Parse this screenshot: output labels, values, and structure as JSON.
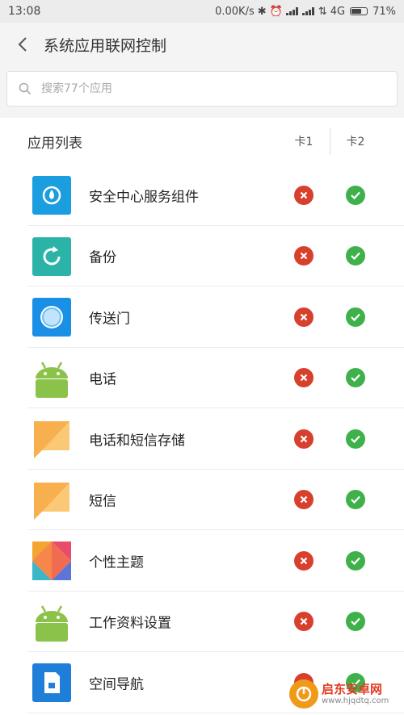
{
  "status": {
    "time": "13:08",
    "speed": "0.00K/s",
    "network": "4G",
    "battery": "71%",
    "battery_level": 0.71
  },
  "header": {
    "title": "系统应用联网控制"
  },
  "search": {
    "placeholder": "搜索77个应用"
  },
  "list": {
    "label": "应用列表",
    "col1": "卡1",
    "col2": "卡2",
    "items": [
      {
        "name": "安全中心服务组件",
        "icon": "security-component-icon",
        "sim1": false,
        "sim2": true
      },
      {
        "name": "备份",
        "icon": "backup-icon",
        "sim1": false,
        "sim2": true
      },
      {
        "name": "传送门",
        "icon": "portal-icon",
        "sim1": false,
        "sim2": true
      },
      {
        "name": "电话",
        "icon": "android-icon",
        "sim1": false,
        "sim2": true
      },
      {
        "name": "电话和短信存储",
        "icon": "message-bubble-icon",
        "sim1": false,
        "sim2": true
      },
      {
        "name": "短信",
        "icon": "message-bubble-icon",
        "sim1": false,
        "sim2": true
      },
      {
        "name": "个性主题",
        "icon": "themes-icon",
        "sim1": false,
        "sim2": true
      },
      {
        "name": "工作资料设置",
        "icon": "android-icon",
        "sim1": false,
        "sim2": true
      },
      {
        "name": "空间导航",
        "icon": "space-navigation-icon",
        "sim1": false,
        "sim2": true
      }
    ]
  },
  "watermark": {
    "text": "启东安卓网",
    "url": "www.hjqdtq.com"
  },
  "colors": {
    "disabled": "#d8402e",
    "enabled": "#3fb14a",
    "accent_blue": "#1a9ee0"
  }
}
